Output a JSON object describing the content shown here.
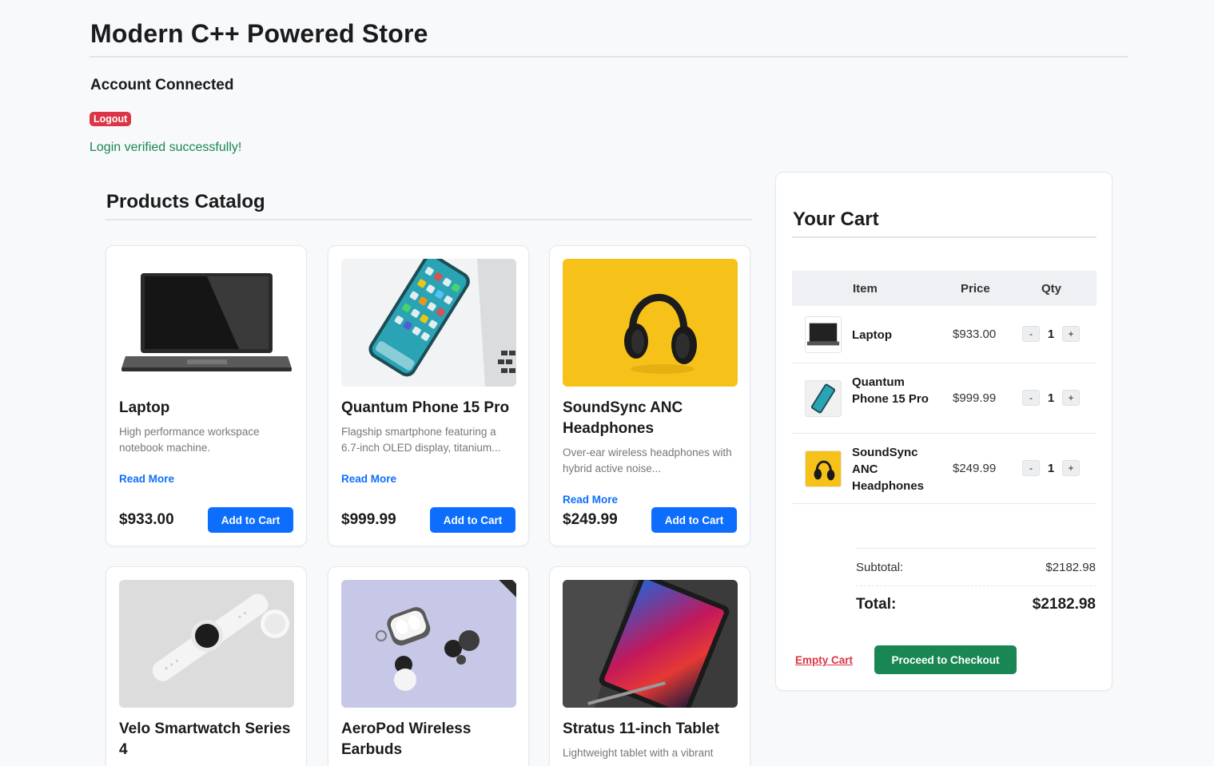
{
  "header": {
    "title": "Modern C++ Powered Store"
  },
  "account": {
    "title": "Account Connected",
    "logout_label": "Logout",
    "status_message": "Login verified successfully!"
  },
  "catalog": {
    "title": "Products Catalog",
    "read_more_label": "Read More",
    "add_to_cart_label": "Add to Cart",
    "products": [
      {
        "name": "Laptop",
        "description": "High performance workspace notebook machine.",
        "price": "$933.00",
        "image": "laptop-image"
      },
      {
        "name": "Quantum Phone 15 Pro",
        "description": "Flagship smartphone featuring a 6.7-inch OLED display, titanium...",
        "price": "$999.99",
        "image": "smartphone-image"
      },
      {
        "name": "SoundSync ANC Headphones",
        "description": "Over-ear wireless headphones with hybrid active noise...",
        "price": "$249.99",
        "image": "headphones-image"
      },
      {
        "name": "Velo Smartwatch Series 4",
        "description": "",
        "price": "",
        "image": "smartwatch-image"
      },
      {
        "name": "AeroPod Wireless Earbuds",
        "description": "",
        "price": "",
        "image": "earbuds-image"
      },
      {
        "name": "Stratus 11-inch Tablet",
        "description": "Lightweight tablet with a vibrant",
        "price": "",
        "image": "tablet-image"
      }
    ]
  },
  "cart": {
    "title": "Your Cart",
    "columns": [
      "Item",
      "Price",
      "Qty"
    ],
    "items": [
      {
        "name": "Laptop",
        "price": "$933.00",
        "qty": "1",
        "image": "laptop-thumbnail"
      },
      {
        "name": "Quantum Phone 15 Pro",
        "price": "$999.99",
        "qty": "1",
        "image": "smartphone-thumbnail"
      },
      {
        "name": "SoundSync ANC Headphones",
        "price": "$249.99",
        "qty": "1",
        "image": "headphones-thumbnail"
      }
    ],
    "minus_label": "-",
    "plus_label": "+",
    "subtotal_label": "Subtotal:",
    "subtotal_value": "$2182.98",
    "total_label": "Total:",
    "total_value": "$2182.98",
    "empty_cart_label": "Empty Cart",
    "checkout_label": "Proceed to Checkout"
  },
  "colors": {
    "primary": "#0d6efd",
    "danger": "#dc3545",
    "success": "#198754",
    "background": "#f8f9fb"
  }
}
